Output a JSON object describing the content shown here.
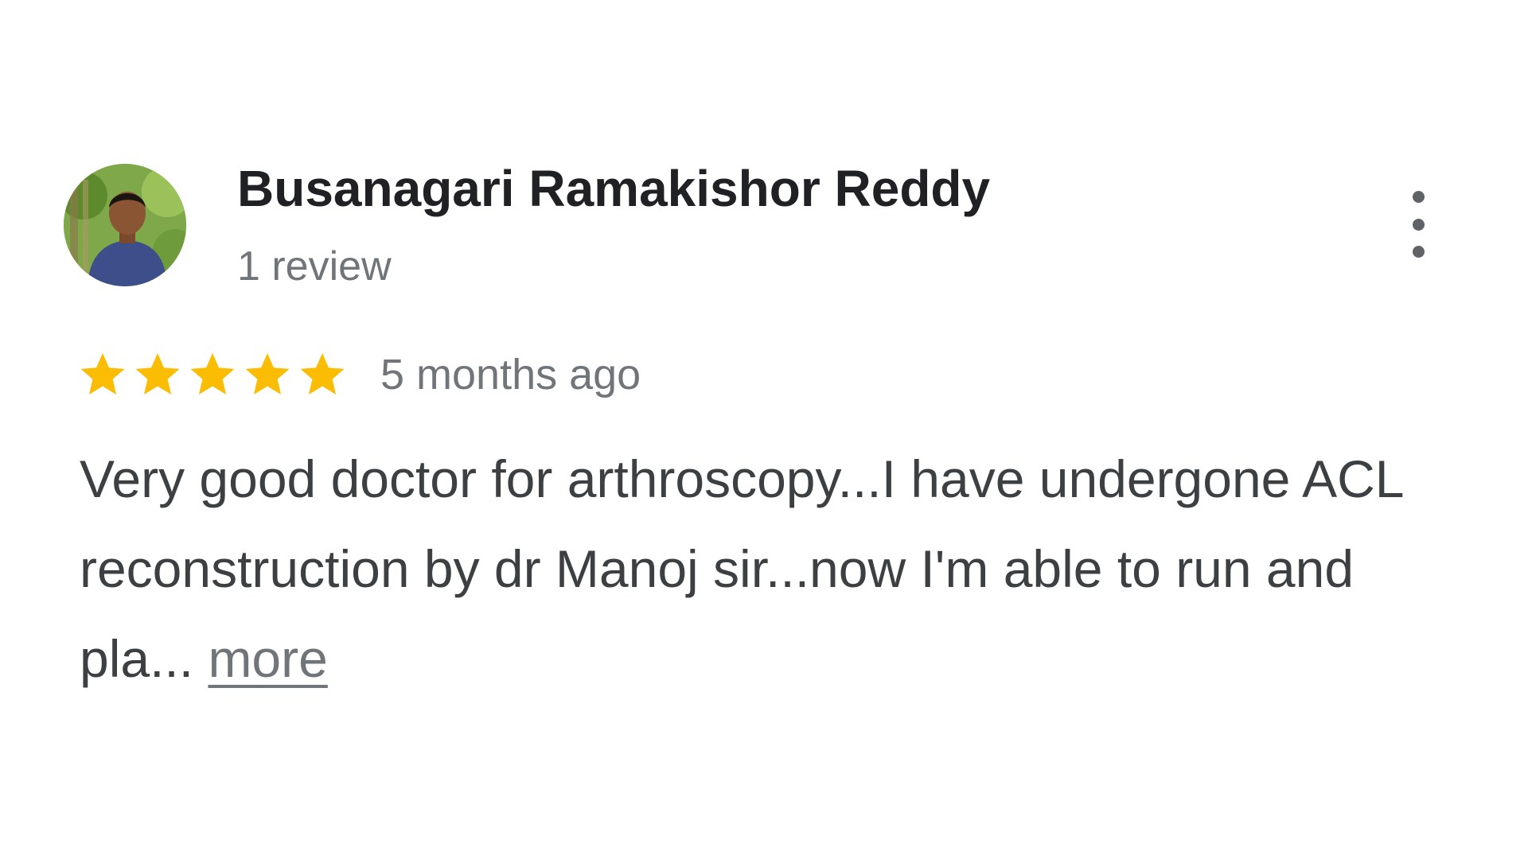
{
  "review": {
    "reviewer_name": "Busanagari Ramakishor Reddy",
    "review_count": "1 review",
    "rating": 5,
    "rating_max": 5,
    "time_ago": "5 months ago",
    "text": "Very good doctor for arthroscopy...I have undergone ACL reconstruction by dr Manoj sir...now I'm able to run and pla...",
    "more_label": "more"
  },
  "icons": {
    "menu": "more-vert-icon",
    "star": "star-icon",
    "avatar": "avatar-photo"
  },
  "colors": {
    "star": "#FBBC04",
    "name": "#202124",
    "secondary": "#70757A",
    "body": "#3C4043"
  }
}
